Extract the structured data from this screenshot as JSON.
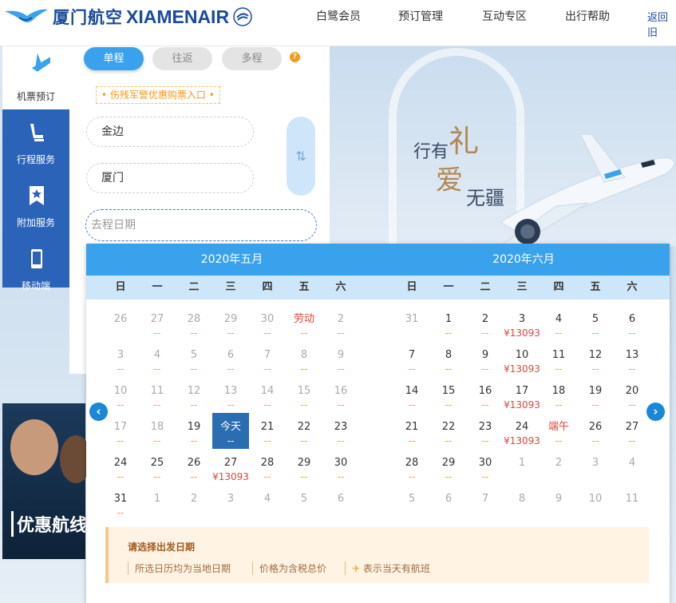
{
  "header": {
    "logo_cn": "厦门航空",
    "logo_en": "XIAMENAIR",
    "nav": [
      "白鹭会员",
      "预订管理",
      "互动专区",
      "出行帮助",
      "返回旧"
    ]
  },
  "sidebar": {
    "items": [
      {
        "label": "机票预订",
        "icon": "plane-icon",
        "active": true
      },
      {
        "label": "行程服务",
        "icon": "seat-icon",
        "active": false
      },
      {
        "label": "附加服务",
        "icon": "bookmark-star-icon",
        "active": false
      },
      {
        "label": "移动端",
        "icon": "phone-icon",
        "active": false
      }
    ]
  },
  "booking": {
    "tabs": [
      "单程",
      "往返",
      "多程"
    ],
    "promo_link": "伤残军警优惠购票入口",
    "from_city": "金边",
    "to_city": "厦门",
    "date_placeholder": "去程日期",
    "swap_icon": "swap-icon"
  },
  "banner": {
    "slogan_1": "行有",
    "slogan_2": "礼",
    "slogan_3": "爱",
    "slogan_4": "无疆",
    "bottom_promo": "优惠航线"
  },
  "calendar": {
    "weekdays": [
      "日",
      "一",
      "二",
      "三",
      "四",
      "五",
      "六"
    ],
    "months": [
      {
        "title": "2020年五月",
        "days": [
          {
            "d": "26",
            "p": "",
            "s": "grey"
          },
          {
            "d": "27",
            "p": "--",
            "s": "grey"
          },
          {
            "d": "28",
            "p": "--",
            "s": "grey"
          },
          {
            "d": "29",
            "p": "--",
            "s": "grey"
          },
          {
            "d": "30",
            "p": "--",
            "s": "grey"
          },
          {
            "d": "劳动",
            "p": "--",
            "s": "holiday"
          },
          {
            "d": "2",
            "p": "--",
            "s": "grey"
          },
          {
            "d": "3",
            "p": "--",
            "s": "grey"
          },
          {
            "d": "4",
            "p": "--",
            "s": "grey"
          },
          {
            "d": "5",
            "p": "--",
            "s": "grey"
          },
          {
            "d": "6",
            "p": "--",
            "s": "grey"
          },
          {
            "d": "7",
            "p": "--",
            "s": "grey"
          },
          {
            "d": "8",
            "p": "--",
            "s": "grey"
          },
          {
            "d": "9",
            "p": "--",
            "s": "grey"
          },
          {
            "d": "10",
            "p": "--",
            "s": "grey"
          },
          {
            "d": "11",
            "p": "--",
            "s": "grey"
          },
          {
            "d": "12",
            "p": "--",
            "s": "grey"
          },
          {
            "d": "13",
            "p": "--",
            "s": "grey"
          },
          {
            "d": "14",
            "p": "--",
            "s": "grey"
          },
          {
            "d": "15",
            "p": "--",
            "s": "grey"
          },
          {
            "d": "16",
            "p": "--",
            "s": "grey"
          },
          {
            "d": "17",
            "p": "--",
            "s": "grey"
          },
          {
            "d": "18",
            "p": "--",
            "s": "grey"
          },
          {
            "d": "19",
            "p": "--",
            "s": "dark"
          },
          {
            "d": "今天",
            "p": "--",
            "s": "today"
          },
          {
            "d": "21",
            "p": "--",
            "s": "dark"
          },
          {
            "d": "22",
            "p": "--",
            "s": "dark"
          },
          {
            "d": "23",
            "p": "--",
            "s": "dark"
          },
          {
            "d": "24",
            "p": "--",
            "s": "dark"
          },
          {
            "d": "25",
            "p": "--",
            "s": "dark"
          },
          {
            "d": "26",
            "p": "--",
            "s": "dark"
          },
          {
            "d": "27",
            "p": "¥13093",
            "s": "dark"
          },
          {
            "d": "28",
            "p": "--",
            "s": "dark"
          },
          {
            "d": "29",
            "p": "--",
            "s": "dark"
          },
          {
            "d": "30",
            "p": "--",
            "s": "dark"
          },
          {
            "d": "31",
            "p": "--",
            "s": "dark"
          },
          {
            "d": "1",
            "p": "",
            "s": "grey"
          },
          {
            "d": "2",
            "p": "",
            "s": "grey"
          },
          {
            "d": "3",
            "p": "",
            "s": "grey"
          },
          {
            "d": "4",
            "p": "",
            "s": "grey"
          },
          {
            "d": "5",
            "p": "",
            "s": "grey"
          },
          {
            "d": "6",
            "p": "",
            "s": "grey"
          }
        ]
      },
      {
        "title": "2020年六月",
        "days": [
          {
            "d": "31",
            "p": "",
            "s": "grey"
          },
          {
            "d": "1",
            "p": "--",
            "s": "dark"
          },
          {
            "d": "2",
            "p": "--",
            "s": "dark"
          },
          {
            "d": "3",
            "p": "¥13093",
            "s": "dark"
          },
          {
            "d": "4",
            "p": "--",
            "s": "dark"
          },
          {
            "d": "5",
            "p": "--",
            "s": "dark"
          },
          {
            "d": "6",
            "p": "--",
            "s": "dark"
          },
          {
            "d": "7",
            "p": "--",
            "s": "dark"
          },
          {
            "d": "8",
            "p": "--",
            "s": "dark"
          },
          {
            "d": "9",
            "p": "--",
            "s": "dark"
          },
          {
            "d": "10",
            "p": "¥13093",
            "s": "dark"
          },
          {
            "d": "11",
            "p": "--",
            "s": "dark"
          },
          {
            "d": "12",
            "p": "--",
            "s": "dark"
          },
          {
            "d": "13",
            "p": "--",
            "s": "dark"
          },
          {
            "d": "14",
            "p": "--",
            "s": "dark"
          },
          {
            "d": "15",
            "p": "--",
            "s": "dark"
          },
          {
            "d": "16",
            "p": "--",
            "s": "dark"
          },
          {
            "d": "17",
            "p": "¥13093",
            "s": "dark"
          },
          {
            "d": "18",
            "p": "--",
            "s": "dark"
          },
          {
            "d": "19",
            "p": "--",
            "s": "dark"
          },
          {
            "d": "20",
            "p": "--",
            "s": "dark"
          },
          {
            "d": "21",
            "p": "--",
            "s": "dark"
          },
          {
            "d": "22",
            "p": "--",
            "s": "dark"
          },
          {
            "d": "23",
            "p": "--",
            "s": "dark"
          },
          {
            "d": "24",
            "p": "¥13093",
            "s": "dark"
          },
          {
            "d": "端午",
            "p": "--",
            "s": "holiday"
          },
          {
            "d": "26",
            "p": "--",
            "s": "dark"
          },
          {
            "d": "27",
            "p": "--",
            "s": "dark"
          },
          {
            "d": "28",
            "p": "--",
            "s": "dark"
          },
          {
            "d": "29",
            "p": "--",
            "s": "dark"
          },
          {
            "d": "30",
            "p": "--",
            "s": "dark"
          },
          {
            "d": "1",
            "p": "",
            "s": "grey"
          },
          {
            "d": "2",
            "p": "",
            "s": "grey"
          },
          {
            "d": "3",
            "p": "",
            "s": "grey"
          },
          {
            "d": "4",
            "p": "",
            "s": "grey"
          },
          {
            "d": "5",
            "p": "",
            "s": "grey"
          },
          {
            "d": "6",
            "p": "",
            "s": "grey"
          },
          {
            "d": "7",
            "p": "",
            "s": "grey"
          },
          {
            "d": "8",
            "p": "",
            "s": "grey"
          },
          {
            "d": "9",
            "p": "",
            "s": "grey"
          },
          {
            "d": "10",
            "p": "",
            "s": "grey"
          },
          {
            "d": "11",
            "p": "",
            "s": "grey"
          }
        ]
      }
    ],
    "note_title": "请选择出发日期",
    "notes": [
      "所选日历均为当地日期",
      "价格为含税总价",
      "表示当天有航班"
    ],
    "prev_icon": "chevron-left-icon",
    "next_icon": "chevron-right-icon"
  },
  "colors": {
    "brand": "#1a4a9c",
    "accent": "#3aa2ec",
    "price": "#e0443a",
    "dash": "#f0a12c"
  }
}
